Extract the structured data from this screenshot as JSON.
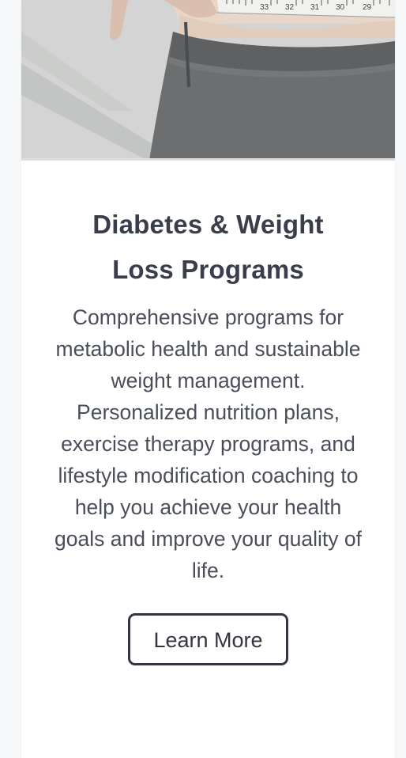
{
  "card": {
    "image_alt": "Person measuring waist with a measuring tape",
    "tape_numbers": [
      "33",
      "32",
      "31",
      "30",
      "29"
    ],
    "title_line1": "Diabetes & Weight",
    "title_line2": "Loss Programs",
    "description": "Comprehensive programs for metabolic health and sustainable weight management. Personalized nutrition plans, exercise therapy programs, and lifestyle modification coaching to help you achieve your health goals and improve your quality of life.",
    "button_label": "Learn More"
  },
  "colors": {
    "title": "#3a3d4a",
    "text": "#4a4e5a",
    "button_border": "#333642",
    "page_bg": "#f7f8fa",
    "card_bg": "#ffffff"
  }
}
